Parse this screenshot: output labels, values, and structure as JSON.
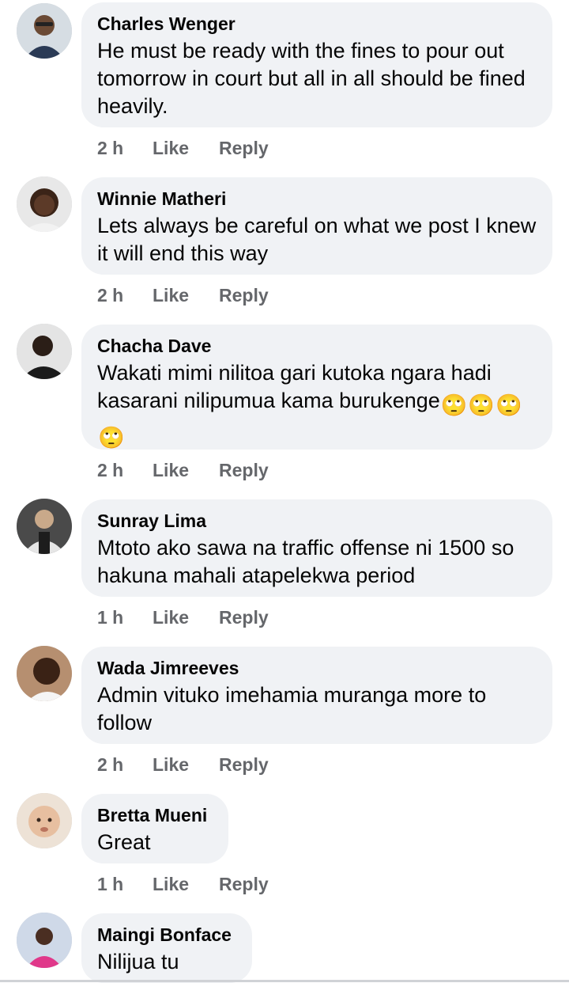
{
  "comments": [
    {
      "name": "Charles Wenger",
      "text": "He must be ready with the fines to pour out tomorrow in court but all in all should be fined heavily.",
      "time": "2 h",
      "like": "Like",
      "reply": "Reply",
      "avatar_color": "#cfd6dc"
    },
    {
      "name": "Winnie Matheri",
      "text": "Lets always be careful on what we post I knew it will end this way",
      "time": "2 h",
      "like": "Like",
      "reply": "Reply",
      "avatar_color": "#e3e3e3"
    },
    {
      "name": "Chacha Dave",
      "text": "Wakati mimi nilitoa gari kutoka ngara hadi kasarani nilipumua kama burukenge",
      "emojis": [
        "🙄",
        "🙄",
        "🙄",
        "🙄"
      ],
      "time": "2 h",
      "like": "Like",
      "reply": "Reply",
      "avatar_color": "#dcdcdc"
    },
    {
      "name": "Sunray Lima",
      "text": "Mtoto ako sawa na traffic offense ni 1500 so hakuna mahali atapelekwa period",
      "time": "1 h",
      "like": "Like",
      "reply": "Reply",
      "avatar_color": "#5a5a5a"
    },
    {
      "name": "Wada Jimreeves",
      "text": "Admin vituko imehamia muranga more to follow",
      "time": "2 h",
      "like": "Like",
      "reply": "Reply",
      "avatar_color": "#b08a6a"
    },
    {
      "name": "Bretta Mueni",
      "text": "Great",
      "time": "1 h",
      "like": "Like",
      "reply": "Reply",
      "avatar_color": "#e8d3c0"
    },
    {
      "name": "Maingi Bonface",
      "text": "Nilijua tu",
      "avatar_color": "#cfd9e8"
    }
  ]
}
